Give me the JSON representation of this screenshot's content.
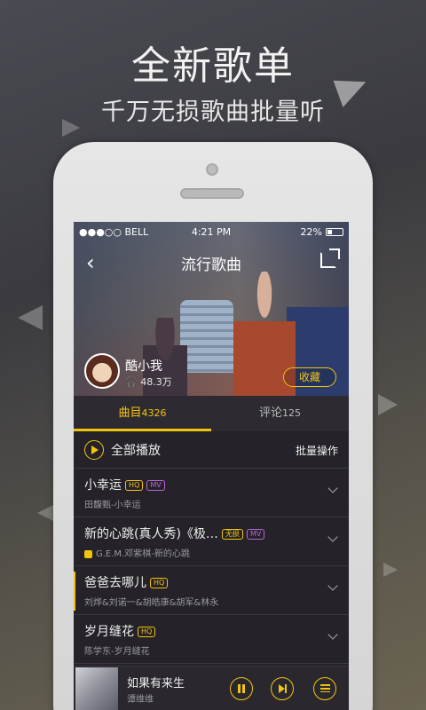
{
  "promo": {
    "headline": "全新歌单",
    "subheadline": "千万无损歌曲批量听"
  },
  "status_bar": {
    "carrier": "●●●○○ BELL",
    "time": "4:21 PM",
    "battery": "22%"
  },
  "nav": {
    "title": "流行歌曲"
  },
  "playlist_owner": {
    "name": "酷小我",
    "plays": "48.3万",
    "favorite_label": "收藏"
  },
  "tabs": [
    {
      "label": "曲目",
      "count": "4326"
    },
    {
      "label": "评论",
      "count": "125"
    }
  ],
  "list_header": {
    "play_all": "全部播放",
    "batch": "批量操作"
  },
  "songs": [
    {
      "title": "小幸运",
      "badges": [
        "HQ",
        "MV"
      ],
      "artist": "田馥甄-小幸运"
    },
    {
      "title": "新的心跳(真人秀)《极…",
      "badges": [
        "无损",
        "MV"
      ],
      "artist": "G.E.M.邓紫棋-新的心跳"
    },
    {
      "title": "爸爸去哪儿",
      "badges": [
        "HQ"
      ],
      "artist": "刘烨&刘诺一&胡皓康&胡军&林永"
    },
    {
      "title": "岁月缝花",
      "badges": [
        "HQ"
      ],
      "artist": "陈学东-岁月缝花"
    }
  ],
  "now_playing": {
    "title": "如果有来生",
    "artist": "谭维维"
  },
  "colors": {
    "accent": "#f1c40f",
    "mv_badge": "#b467d8"
  }
}
